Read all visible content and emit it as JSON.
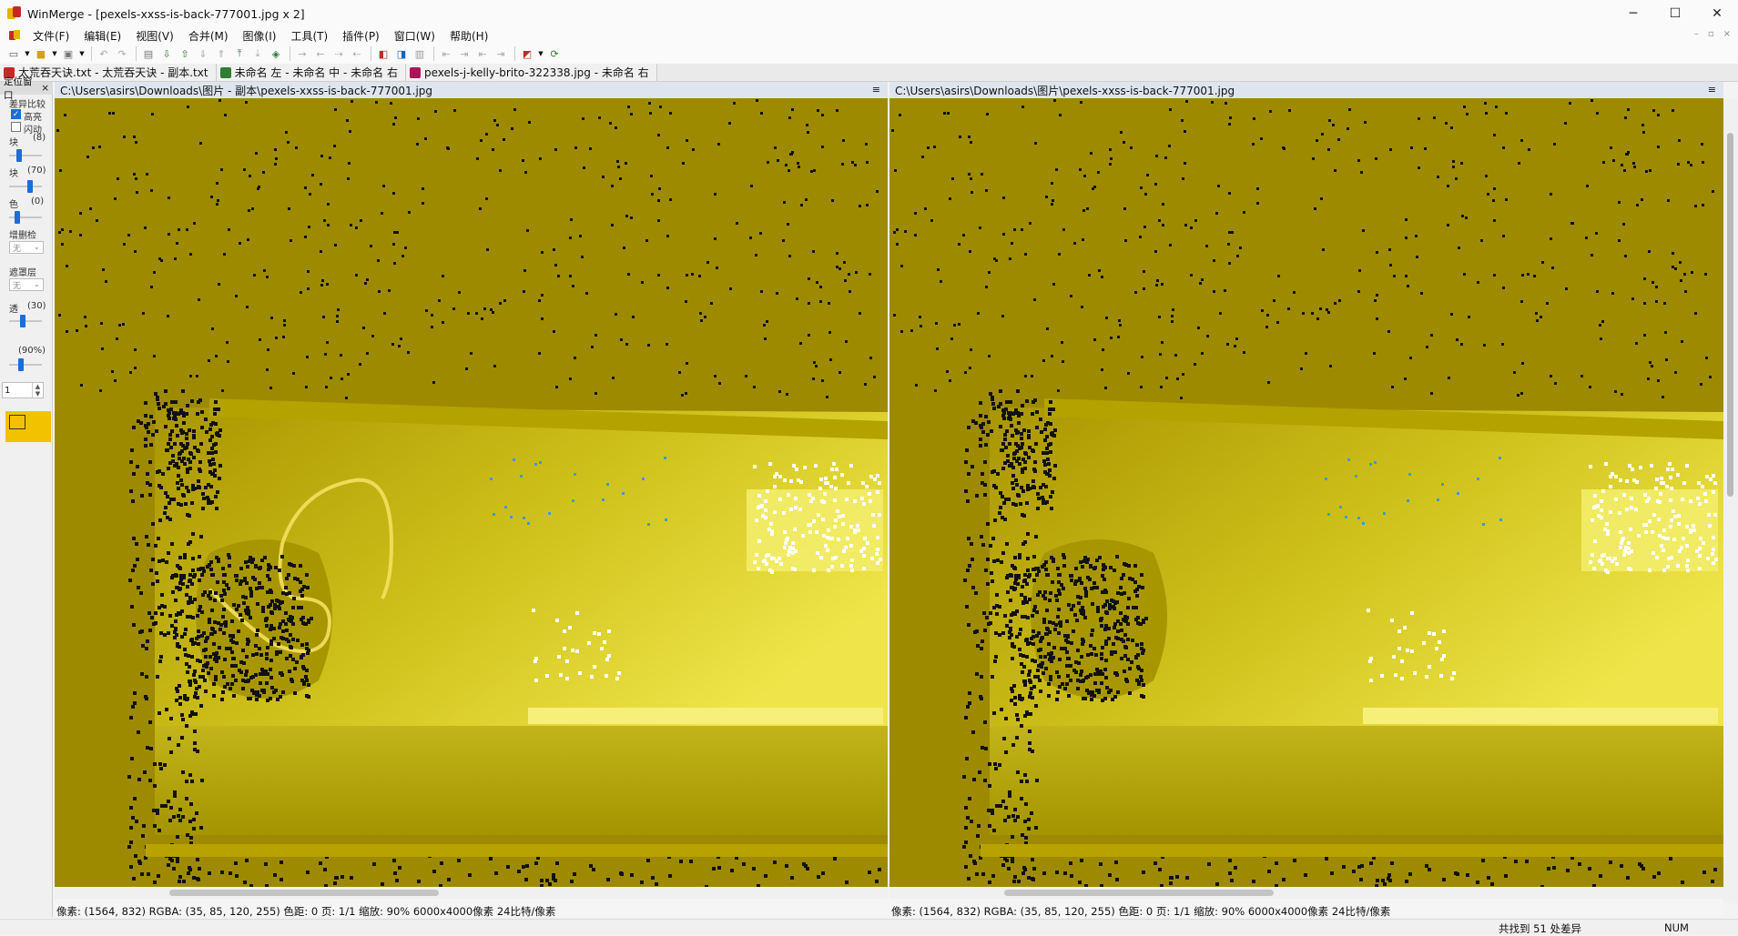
{
  "window": {
    "title": "WinMerge - [pexels-xxss-is-back-777001.jpg x 2]",
    "controls": {
      "minimize": "─",
      "maximize": "☐",
      "close": "✕"
    }
  },
  "menu": {
    "items": [
      "文件(F)",
      "编辑(E)",
      "视图(V)",
      "合并(M)",
      "图像(I)",
      "工具(T)",
      "插件(P)",
      "窗口(W)",
      "帮助(H)"
    ],
    "mdi": {
      "minimize": "–",
      "restore": "▫",
      "close": "×"
    }
  },
  "tabs": [
    {
      "label": "太荒吞天诀.txt - 太荒吞天诀 - 副本.txt",
      "icon_color": "#c62828"
    },
    {
      "label": "未命名 左 - 未命名 中 - 未命名 右",
      "icon_color": "#2e7d32"
    },
    {
      "label": "pexels-j-kelly-brito-322338.jpg - 未命名 右",
      "icon_color": "#ad1457"
    }
  ],
  "location_panel": {
    "header": "定位窗口",
    "close": "×",
    "diff_compare_label": "差异比较",
    "highlight": {
      "label": "高亮",
      "checked": true
    },
    "blink": {
      "label": "闪动",
      "checked": false
    },
    "block_size": {
      "label": "块",
      "value": "(8)"
    },
    "block_threshold": {
      "label": "块",
      "value": "(70)"
    },
    "color_distance": {
      "label": "色",
      "value": "(0)"
    },
    "insertion_deletion_label": "增删检",
    "insertion_deletion_value": "无",
    "overlay_label": "遮罩层",
    "overlay_value": "无",
    "transparency": {
      "label": "透",
      "value": "(30)"
    },
    "zoom": {
      "value": "(90%)"
    },
    "page_spinner": {
      "value": "1"
    },
    "diff_color": "#f2c200"
  },
  "left_pane": {
    "path": "C:\\Users\\asirs\\Downloads\\图片 - 副本\\pexels-xxss-is-back-777001.jpg",
    "menu_icon": "≡",
    "status": "像素: (1564, 832)  RGBA: (35, 85, 120, 255)  色距: 0  页: 1/1  缩放: 90%  6000x4000像素  24比特/像素"
  },
  "right_pane": {
    "path": "C:\\Users\\asirs\\Downloads\\图片\\pexels-xxss-is-back-777001.jpg",
    "menu_icon": "≡",
    "status": "像素: (1564, 832)  RGBA: (35, 85, 120, 255)  色距: 0  页: 1/1  缩放: 90%  6000x4000像素  24比特/像素"
  },
  "statusbar": {
    "diff_count": "共找到 51 处差异",
    "numlock": "NUM"
  },
  "colors": {
    "diff_overlay": "#f2c200",
    "image_base": "#9e8a00",
    "sky_glow": "#e9e240",
    "accent_blue": "#1a6ed8"
  }
}
